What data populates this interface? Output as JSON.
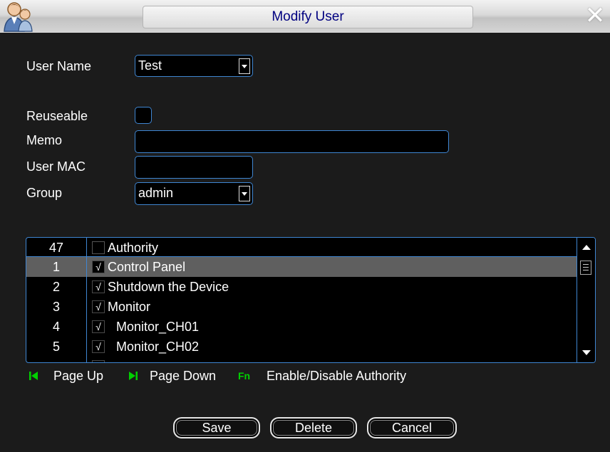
{
  "window": {
    "title": "Modify User",
    "app_icon": "users-icon",
    "close_icon": "close-icon",
    "close_glyph": "✕"
  },
  "form": {
    "user_name": {
      "label": "User Name",
      "value": "Test"
    },
    "reuseable": {
      "label": "Reuseable",
      "checked": false
    },
    "memo": {
      "label": "Memo",
      "value": ""
    },
    "user_mac": {
      "label": "User MAC",
      "value": ""
    },
    "group": {
      "label": "Group",
      "value": "admin"
    }
  },
  "authority_table": {
    "total": "47",
    "header": "Authority",
    "rows": [
      {
        "num": "1",
        "label": "Control Panel",
        "checked": true,
        "indent": 0,
        "selected": true
      },
      {
        "num": "2",
        "label": "Shutdown the Device",
        "checked": true,
        "indent": 0,
        "selected": false
      },
      {
        "num": "3",
        "label": "Monitor",
        "checked": true,
        "indent": 0,
        "selected": false
      },
      {
        "num": "4",
        "label": "Monitor_CH01",
        "checked": true,
        "indent": 1,
        "selected": false
      },
      {
        "num": "5",
        "label": "Monitor_CH02",
        "checked": true,
        "indent": 1,
        "selected": false
      }
    ],
    "check_glyph": "√"
  },
  "hints": {
    "page_up": "Page Up",
    "page_down": "Page Down",
    "fn_label": "Fn",
    "enable_disable": "Enable/Disable Authority"
  },
  "buttons": {
    "save": "Save",
    "delete": "Delete",
    "cancel": "Cancel"
  },
  "colors": {
    "accent": "#3f86d2",
    "title_text": "#000080",
    "hint_icon": "#00d000",
    "selected_row": "#5f5f5f",
    "background": "#1b1b1b"
  }
}
